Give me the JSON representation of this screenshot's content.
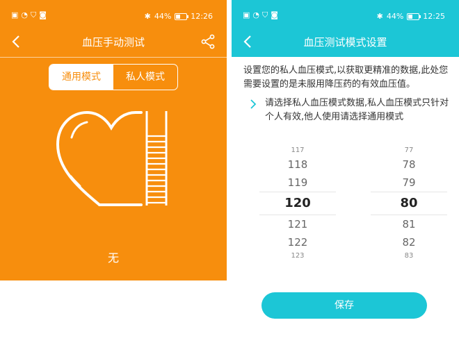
{
  "left": {
    "status": {
      "battery": "44%",
      "time": "12:26"
    },
    "nav": {
      "title": "血压手动测试"
    },
    "segments": [
      "通用模式",
      "私人模式"
    ],
    "result": "无"
  },
  "right": {
    "status": {
      "battery": "44%",
      "time": "12:25"
    },
    "nav": {
      "title": "血压测试模式设置"
    },
    "description": "设置您的私人血压模式,以获取更精准的数据,此处您需要设置的是未服用降压药的有效血压值。",
    "hint": "请选择私人血压模式数据,私人血压模式只针对个人有效,他人使用请选择通用模式",
    "systolic": {
      "values": [
        "117",
        "118",
        "119",
        "120",
        "121",
        "122",
        "123"
      ],
      "selected": "120"
    },
    "diastolic": {
      "values": [
        "77",
        "78",
        "79",
        "80",
        "81",
        "82",
        "83"
      ],
      "selected": "80"
    },
    "save_label": "保存"
  },
  "colors": {
    "left_bg": "#f78e0d",
    "right_accent": "#1cc6d6"
  }
}
